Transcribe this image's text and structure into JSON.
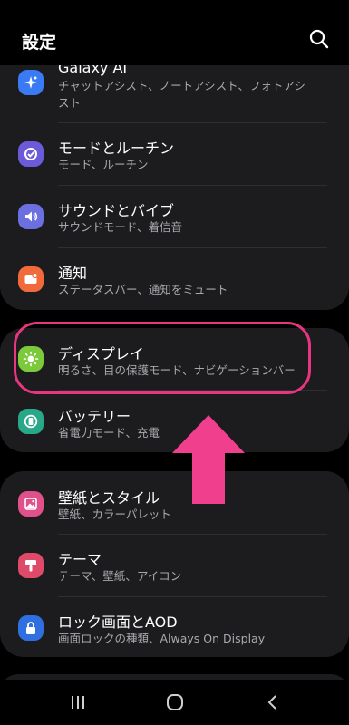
{
  "header": {
    "title": "設定",
    "search_icon": "search-icon"
  },
  "group1": {
    "items": [
      {
        "title": "Galaxy AI",
        "subtitle_line1": "チャットアシスト、ノートアシスト、フォトアシ",
        "subtitle_line2": "スト",
        "icon": "galaxy-ai-icon",
        "icon_color": "#3a7bf5"
      },
      {
        "title": "モードとルーチン",
        "subtitle": "モード、ルーチン",
        "icon": "modes-routines-icon",
        "icon_color": "#6b5bd8"
      },
      {
        "title": "サウンドとバイブ",
        "subtitle": "サウンドモード、着信音",
        "icon": "sound-icon",
        "icon_color": "#6b6fe0"
      },
      {
        "title": "通知",
        "subtitle": "ステータスバー、通知をミュート",
        "icon": "notifications-icon",
        "icon_color": "#f06a3b"
      }
    ]
  },
  "group2": {
    "items": [
      {
        "title": "ディスプレイ",
        "subtitle": "明るさ、目の保護モード、ナビゲーションバー",
        "icon": "display-icon",
        "icon_color": "#7cc93c"
      },
      {
        "title": "バッテリー",
        "subtitle": "省電力モード、充電",
        "icon": "battery-icon",
        "icon_color": "#28a889"
      }
    ]
  },
  "group3": {
    "items": [
      {
        "title": "壁紙とスタイル",
        "subtitle": "壁紙、カラーパレット",
        "icon": "wallpaper-icon",
        "icon_color": "#e0508a"
      },
      {
        "title": "テーマ",
        "subtitle": "テーマ、壁紙、アイコン",
        "icon": "themes-icon",
        "icon_color": "#e04a6a"
      },
      {
        "title": "ロック画面とAOD",
        "subtitle": "画面ロックの種類、Always On Display",
        "icon": "lock-icon",
        "icon_color": "#2f6fe0"
      }
    ]
  },
  "annotations": {
    "highlight_color": "#e8357f",
    "arrow_color": "#ef3f8d"
  },
  "navbar": {
    "recent": "recent-apps-icon",
    "home": "home-icon",
    "back": "back-icon"
  }
}
